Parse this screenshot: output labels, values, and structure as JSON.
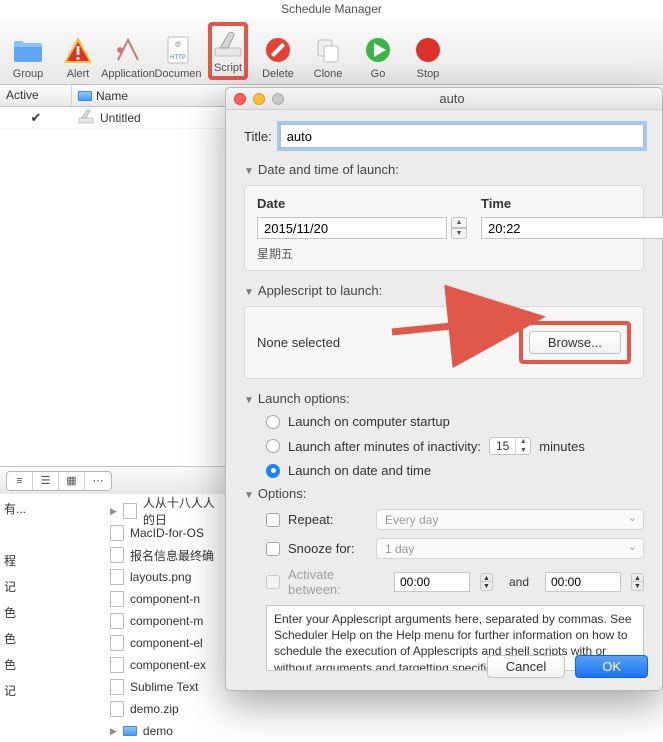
{
  "window": {
    "title": "Schedule Manager",
    "toolbar": [
      {
        "label": "Group"
      },
      {
        "label": "Alert"
      },
      {
        "label": "Application"
      },
      {
        "label": "Documen"
      },
      {
        "label": "Script"
      },
      {
        "label": "Delete"
      },
      {
        "label": "Clone"
      },
      {
        "label": "Go"
      },
      {
        "label": "Stop"
      }
    ],
    "columns": {
      "active": "Active",
      "name": "Name"
    },
    "rows": [
      {
        "checked": true,
        "name": "Untitled"
      }
    ]
  },
  "tree_left": [
    "有...",
    "",
    "程",
    "记",
    "色",
    "色",
    "色",
    "记"
  ],
  "tree": [
    {
      "name": "人从十八人人的日",
      "disclosure": "▶"
    },
    {
      "name": "MacID-for-OS"
    },
    {
      "name": "报名信息最终确"
    },
    {
      "name": "layouts.png"
    },
    {
      "name": "component-n"
    },
    {
      "name": "component-m"
    },
    {
      "name": "component-el"
    },
    {
      "name": "component-ex"
    },
    {
      "name": "Sublime Text "
    },
    {
      "name": "demo.zip"
    },
    {
      "name": "demo",
      "disclosure": "▶",
      "folder": true
    }
  ],
  "dialog": {
    "title": "auto",
    "title_field": {
      "label": "Title:",
      "value": "auto"
    },
    "datetime_label": "Date and time of launch:",
    "date": {
      "label": "Date",
      "value": "2015/11/20",
      "dow": "星期五"
    },
    "time": {
      "label": "Time",
      "value": "20:22"
    },
    "applescript_label": "Applescript to launch:",
    "applescript_none": "None selected",
    "browse": "Browse...",
    "launch_options_label": "Launch options:",
    "launch_opts": {
      "startup": "Launch on computer startup",
      "inactivity": "Launch after minutes of inactivity:",
      "inactivity_value": "15",
      "inactivity_unit": "minutes",
      "datetime": "Launch on date and time"
    },
    "options_label": "Options:",
    "repeat_label": "Repeat:",
    "repeat_value": "Every day",
    "snooze_label": "Snooze for:",
    "snooze_value": "1 day",
    "activate_label": "Activate between:",
    "activate_from": "00:00",
    "activate_and": "and",
    "activate_to": "00:00",
    "args_text": "Enter your Applescript arguments here, separated by commas. See Scheduler Help on the Help menu for further information on how to schedule the execution of Applescripts and shell scripts with or without arguments and targetting specific routines.",
    "cancel": "Cancel",
    "ok": "OK"
  }
}
